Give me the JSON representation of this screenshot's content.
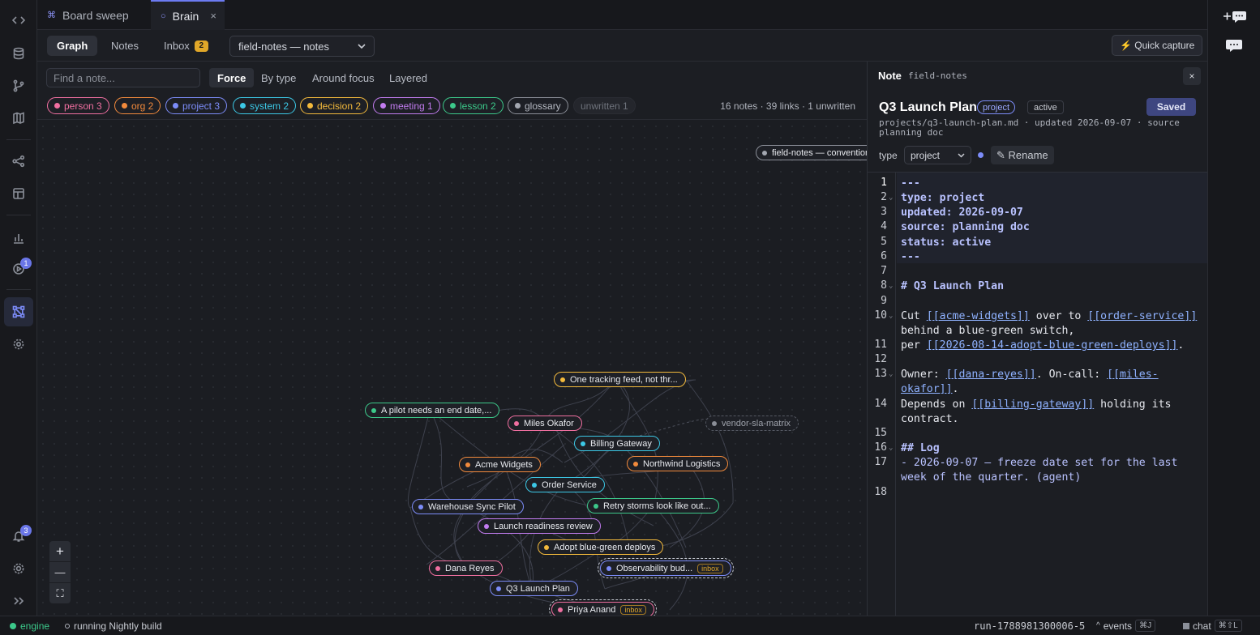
{
  "tabs": [
    {
      "icon": "⌘",
      "label": "Board sweep"
    },
    {
      "icon": "○",
      "label": "Brain",
      "close": "×"
    }
  ],
  "toolbar": {
    "views": [
      "Graph",
      "Notes",
      "Inbox"
    ],
    "inbox_count": "2",
    "vault_select": "field-notes — notes",
    "quick_capture": "⚡ Quick capture"
  },
  "graph": {
    "search_placeholder": "Find a note...",
    "modes": [
      "Force",
      "By type",
      "Around focus",
      "Layered"
    ],
    "chips": [
      {
        "label": "person 3",
        "color": "#f06fa0"
      },
      {
        "label": "org 2",
        "color": "#f28a3c"
      },
      {
        "label": "project 3",
        "color": "#7c8cf8"
      },
      {
        "label": "system 2",
        "color": "#3cc8e6"
      },
      {
        "label": "decision 2",
        "color": "#f2b93c"
      },
      {
        "label": "meeting 1",
        "color": "#c27cf0"
      },
      {
        "label": "lesson 2",
        "color": "#3cc88a"
      },
      {
        "label": "glossary",
        "color": "#a3a7b0"
      },
      {
        "label": "unwritten 1",
        "color": "#6a6e77"
      }
    ],
    "stats": "16 notes · 39 links · 1 unwritten",
    "nodes": [
      {
        "label": "field-notes — conventions",
        "color": "#a3a7b0"
      },
      {
        "label": "One tracking feed, not thr...",
        "color": "#f2b93c"
      },
      {
        "label": "A pilot needs an end date,...",
        "color": "#3cc88a"
      },
      {
        "label": "Miles Okafor",
        "color": "#f06fa0"
      },
      {
        "label": "vendor-sla-matrix",
        "color": "#8a8e97"
      },
      {
        "label": "Billing Gateway",
        "color": "#3cc8e6"
      },
      {
        "label": "Acme Widgets",
        "color": "#f28a3c"
      },
      {
        "label": "Northwind Logistics",
        "color": "#f28a3c"
      },
      {
        "label": "Order Service",
        "color": "#3cc8e6"
      },
      {
        "label": "Warehouse Sync Pilot",
        "color": "#7c8cf8"
      },
      {
        "label": "Retry storms look like out...",
        "color": "#3cc88a"
      },
      {
        "label": "Launch readiness review",
        "color": "#c27cf0"
      },
      {
        "label": "Adopt blue-green deploys",
        "color": "#f2b93c"
      },
      {
        "label": "Dana Reyes",
        "color": "#f06fa0"
      },
      {
        "label": "Observability bud...",
        "color": "#7c8cf8",
        "tag": "inbox"
      },
      {
        "label": "Q3 Launch Plan",
        "color": "#7c8cf8"
      },
      {
        "label": "Priya Anand",
        "color": "#f06fa0",
        "tag": "inbox"
      }
    ],
    "zoom": [
      "+",
      "—",
      "⛶"
    ]
  },
  "note": {
    "header": "Note",
    "vault": "field-notes",
    "close": "×",
    "title": "Q3 Launch Plan",
    "type_badge": "project",
    "status_badge": "active",
    "saved": "Saved",
    "meta": "projects/q3-launch-plan.md · updated 2026-09-07 · source planning doc",
    "type_label": "type",
    "type_value": "project",
    "rename": "✎ Rename",
    "lines": {
      "l1": "---",
      "l2": "type: project",
      "l3": "updated: 2026-09-07",
      "l4": "source: planning doc",
      "l5": "status: active",
      "l6": "---",
      "l8": "# Q3 Launch Plan",
      "l10a": "Cut ",
      "l10b": "[[acme-widgets]]",
      "l10c": " over to ",
      "l10d": "[[order-service]]",
      "l10e": "behind a blue-green switch,",
      "l11a": "per ",
      "l11b": "[[2026-08-14-adopt-blue-green-deploys]]",
      "l11c": ".",
      "l13a": "Owner: ",
      "l13b": "[[dana-reyes]]",
      "l13c": ". On-call: ",
      "l13d": "[[miles-",
      "l13e": "okafor]]",
      "l13f": ".",
      "l14a": "Depends on ",
      "l14b": "[[billing-gateway]]",
      "l14c": " holding its",
      "l14d": "contract.",
      "l16": "## Log",
      "l17a": "- 2026-09-07 — freeze date set for the last",
      "l17b": "week of the quarter. (agent)"
    },
    "line_numbers": [
      "1",
      "2",
      "3",
      "4",
      "5",
      "6",
      "7",
      "8",
      "9",
      "10",
      "11",
      "12",
      "13",
      "14",
      "15",
      "16",
      "17",
      "18"
    ]
  },
  "rail": {
    "badge_run": "1",
    "badge_notif": "3"
  },
  "status": {
    "engine": "engine",
    "running": "running Nightly build",
    "run_id": "run-1788981300006-5",
    "events": "events",
    "events_kbd": "⌘J",
    "chat": "chat",
    "chat_kbd": "⌘⇧L"
  }
}
